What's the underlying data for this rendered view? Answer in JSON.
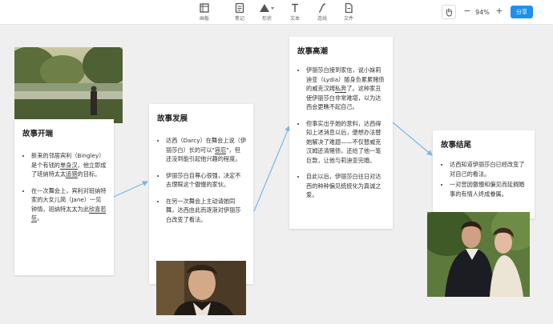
{
  "toolbar": {
    "tools": [
      {
        "label": "画板",
        "icon": "frame-icon"
      },
      {
        "label": "笔记",
        "icon": "note-icon"
      },
      {
        "label": "形状",
        "icon": "shape-icon"
      },
      {
        "label": "文本",
        "icon": "text-icon"
      },
      {
        "label": "连线",
        "icon": "connector-icon"
      },
      {
        "label": "文件",
        "icon": "file-icon"
      }
    ],
    "zoom": "94%",
    "zoom_out": "−",
    "zoom_in": "+",
    "share_label": "分享"
  },
  "cards": {
    "start": {
      "title": "故事开端",
      "p1": [
        "新来的邻居宾利（Bingley）是个有钱的",
        "单身汉",
        "，他立即成了班纳特太太",
        "追猎",
        "的目标。"
      ],
      "p2": [
        "在一次舞会上，宾利对班纳特家的大女儿简（Jane）一见钟情，班纳特太太为此",
        "欣喜若狂",
        "。"
      ]
    },
    "development": {
      "title": "故事发展",
      "p1": [
        "达西（Darcy）在舞会上说（伊丽莎白）长的可以\"",
        "容忍",
        "\"，但还没到能引起他兴趣的程度。"
      ],
      "p2": "伊丽莎白自尊心很强，决定不去理睬这个傲慢的家伙。",
      "p3": "在另一次舞会上主动请她同舞，达西由此而逐渐对伊丽莎白改变了看法。"
    },
    "climax": {
      "title": "故事高潮",
      "p1": [
        "伊丽莎白接到家信，说小妹莉迪亚（Lydia）随身负累累赌债的威克汉姆",
        "私奔",
        "了。这种家丑使伊丽莎白非常难堪，以为达西会更瞧不起自己。"
      ],
      "p2": "但事实出乎她的意料，达西得知上述消息以后，便想办法替她解决了难题——不仅替威克汉姆还清赌债，还给了他一笔巨款，让他与莉迪亚完婚。",
      "p3": "自此以后，伊丽莎白往日对达西的种种偏见统统化为真诚之爱。"
    },
    "ending": {
      "title": "故事结尾",
      "p1": "达西知道伊丽莎白已经改变了对自己的看法。",
      "p2": "一对曾因傲慢和偏见而延搁婚事的有情人终成眷属。"
    }
  }
}
